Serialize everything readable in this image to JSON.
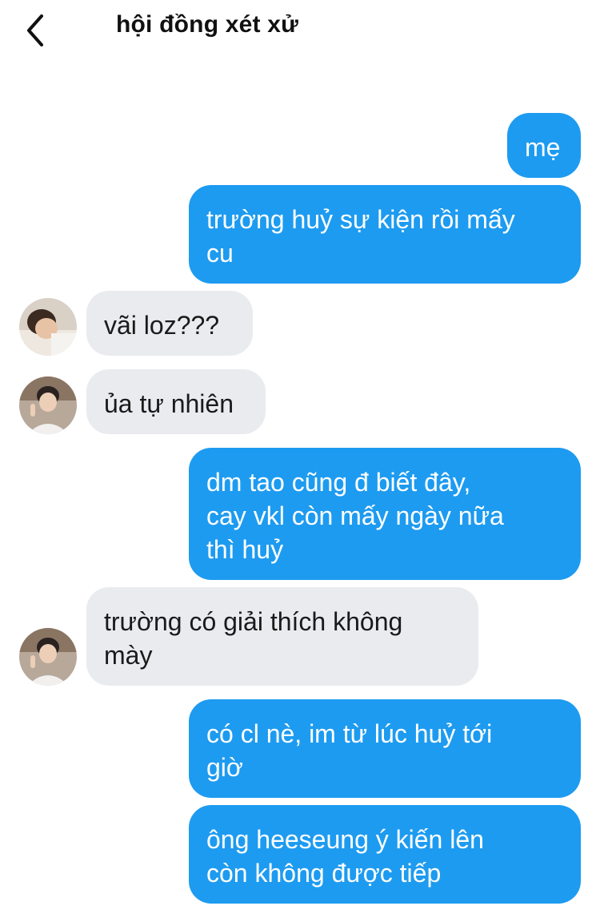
{
  "header": {
    "title": "hội đồng xét xử"
  },
  "messages": [
    {
      "sender": "me",
      "lines": [
        "mẹ"
      ]
    },
    {
      "sender": "me",
      "lines": [
        "trường huỷ sự kiện rồi mấy",
        "cu"
      ]
    },
    {
      "sender": "friend-1",
      "lines": [
        "vãi loz???"
      ]
    },
    {
      "sender": "friend-2",
      "lines": [
        "ủa tự nhiên"
      ]
    },
    {
      "sender": "me",
      "lines": [
        "dm tao cũng đ biết đây,",
        "cay vkl còn mấy ngày nữa",
        "thì huỷ"
      ]
    },
    {
      "sender": "friend-2",
      "lines": [
        "trường có giải thích không",
        "mày"
      ]
    },
    {
      "sender": "me",
      "lines": [
        "có cl nè, im từ lúc huỷ tới",
        "giờ"
      ]
    },
    {
      "sender": "me",
      "lines": [
        "ông heeseung ý kiến lên",
        "còn không được tiếp"
      ]
    }
  ],
  "colors": {
    "outgoing": "#1d9bf0",
    "incoming": "#e9ebef"
  },
  "icons": {
    "back": "chevron-left-icon"
  }
}
